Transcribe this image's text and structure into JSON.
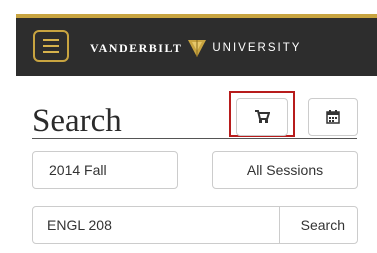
{
  "header": {
    "brand_left": "VANDERBILT",
    "brand_right": "UNIVERSITY",
    "accent_color": "#c8a440",
    "background_color": "#2d2d2d",
    "menu_icon": "hamburger-icon",
    "logo_icon": "vanderbilt-oak-leaf-icon"
  },
  "page": {
    "title": "Search"
  },
  "toolbar": {
    "cart_icon": "cart-icon",
    "calendar_icon": "calendar-icon",
    "highlight_color": "#b71c1c"
  },
  "filters": {
    "term": "2014 Fall",
    "session": "All Sessions"
  },
  "search": {
    "value": "ENGL 208",
    "button_label": "Search"
  }
}
